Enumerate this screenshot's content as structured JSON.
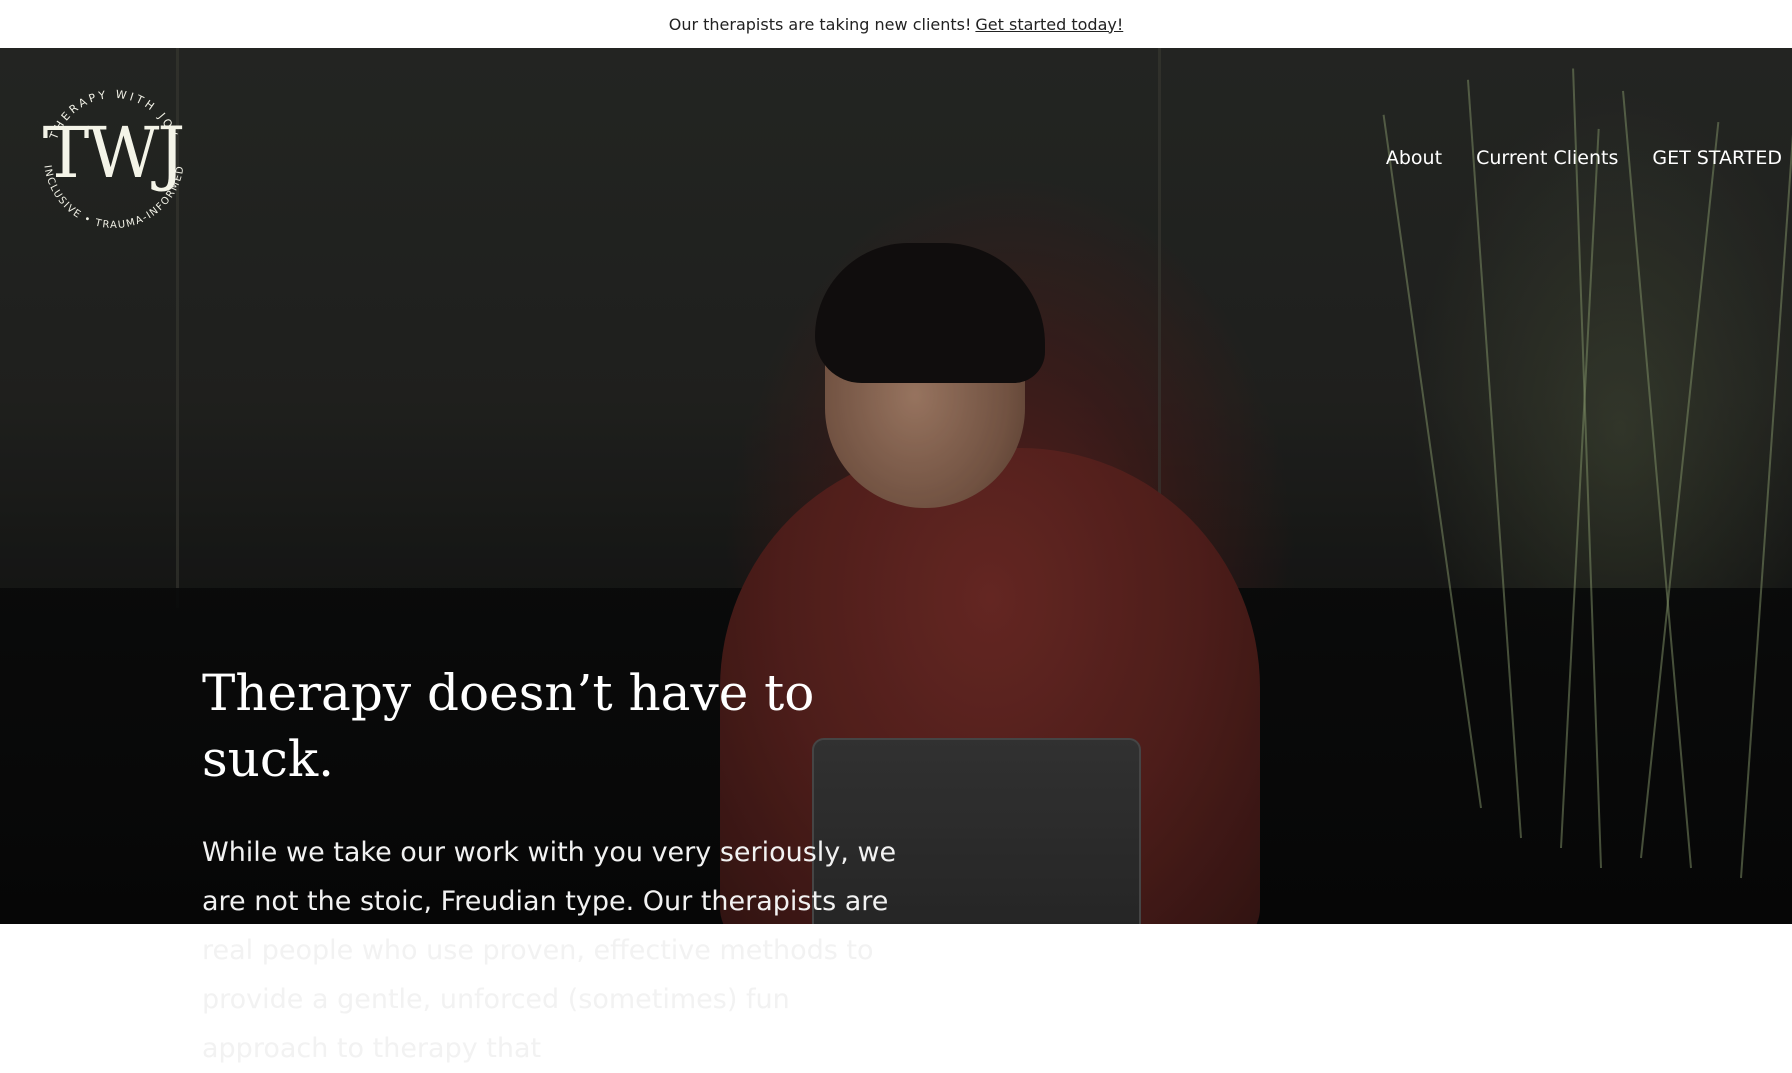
{
  "announcement": {
    "text": "Our therapists are taking new clients!",
    "link_text": "Get started today!"
  },
  "logo": {
    "mark": "TWJ",
    "ring_top": "THERAPY WITH JOY",
    "ring_bottom": "INCLUSIVE • TRAUMA-INFORMED"
  },
  "nav": {
    "items": [
      {
        "label": "About"
      },
      {
        "label": "Current Clients"
      },
      {
        "label": "GET STARTED"
      }
    ]
  },
  "hero": {
    "heading": "Therapy doesn’t have to suck.",
    "body": "While we take our work with you very seriously, we are not the stoic, Freudian type. Our therapists are real people who use proven, effective methods to provide a gentle, unforced (sometimes) fun approach to therapy that"
  },
  "colors": {
    "announcement_bg": "#ffffff",
    "announcement_text": "#222222",
    "logo": "#f1f1e6",
    "hero_text": "#ffffff"
  }
}
